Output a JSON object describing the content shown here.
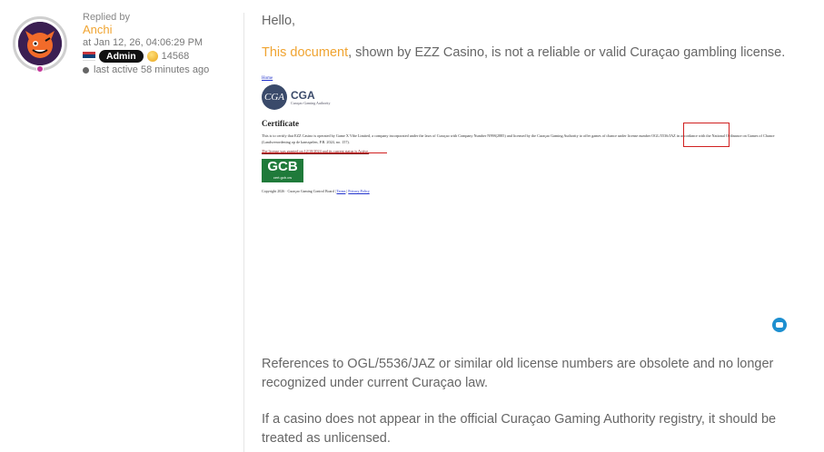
{
  "post": {
    "replied_label": "Replied by",
    "username": "Anchi",
    "date": "at Jan 12, 26, 04:06:29 PM",
    "role": "Admin",
    "points": "14568",
    "last_active": "last active 58 minutes ago",
    "greeting": "Hello,",
    "link_text": "This document",
    "intro_rest": ", shown by EZZ Casino, is not a reliable or valid Curaçao gambling license.",
    "para_obsolete": "References to OGL/5536/JAZ or similar old license numbers are obsolete and no longer recognized under current Curaçao law.",
    "para_registry": "If a casino does not appear in the official Curaçao Gaming Authority registry, it should be treated as unlicensed."
  },
  "certificate": {
    "home": "Home",
    "logo_initials": "CGA",
    "logo_title": "CGA",
    "logo_sub": "Curaçao Gaming Authority",
    "heading": "Certificate",
    "body": "This is to certify that EZZ Casino is operated by Game X Vibe Limited, a company incorporated under the laws of Curaçao with Company Number N998(2885) and licensed by the Curaçao Gaming Authority to offer games of chance under license number OGL/5536/JAZ in accordance with the National Ordinance on Games of Chance (Landsverordening op de kansspelen, P.B. 2024, no. 157).",
    "granted": "The license was granted on 12/10/2024 and its current status is Active.",
    "gcb_big": "GCB",
    "gcb_small": "cert.gcb.cw",
    "copyright": "Copyright 2026 · Curaçao Gaming Control Board |",
    "terms": "Terms",
    "privacy": "Privacy Policy"
  },
  "colors": {
    "accent": "#f0a431",
    "role_bg": "#111111",
    "chat_button": "#1d8fd0",
    "highlight_red": "#d02020",
    "gcb_green": "#1f7a3a"
  },
  "icons": {
    "avatar": "avatar-icon",
    "flag": "flag-icon",
    "coin": "coin-icon",
    "status": "status-dot-icon",
    "chat": "chat-icon"
  }
}
